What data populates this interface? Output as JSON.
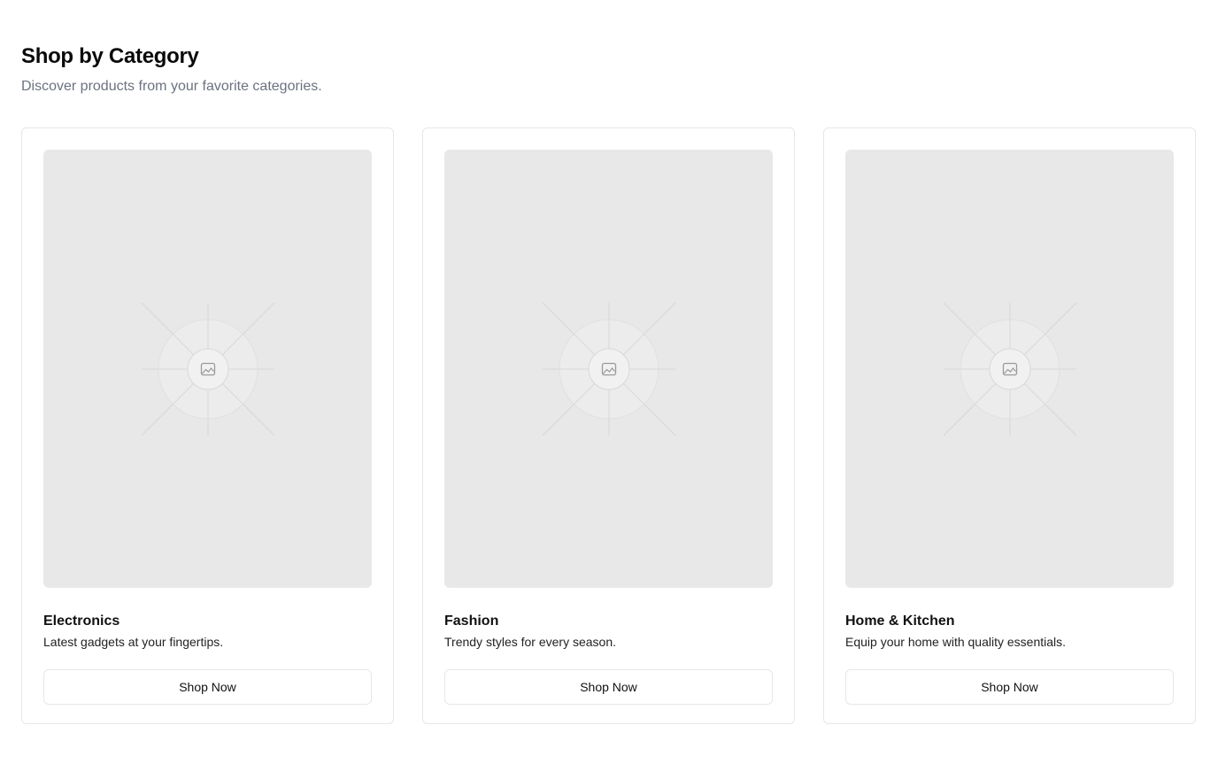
{
  "header": {
    "title": "Shop by Category",
    "subtitle": "Discover products from your favorite categories."
  },
  "categories": [
    {
      "name": "Electronics",
      "description": "Latest gadgets at your fingertips.",
      "button_label": "Shop Now",
      "image_icon": "image-placeholder-icon"
    },
    {
      "name": "Fashion",
      "description": "Trendy styles for every season.",
      "button_label": "Shop Now",
      "image_icon": "image-placeholder-icon"
    },
    {
      "name": "Home & Kitchen",
      "description": "Equip your home with quality essentials.",
      "button_label": "Shop Now",
      "image_icon": "image-placeholder-icon"
    }
  ],
  "colors": {
    "card_border": "#e5e7eb",
    "image_placeholder": "#e8e8e8",
    "subtitle": "#6b7280"
  }
}
